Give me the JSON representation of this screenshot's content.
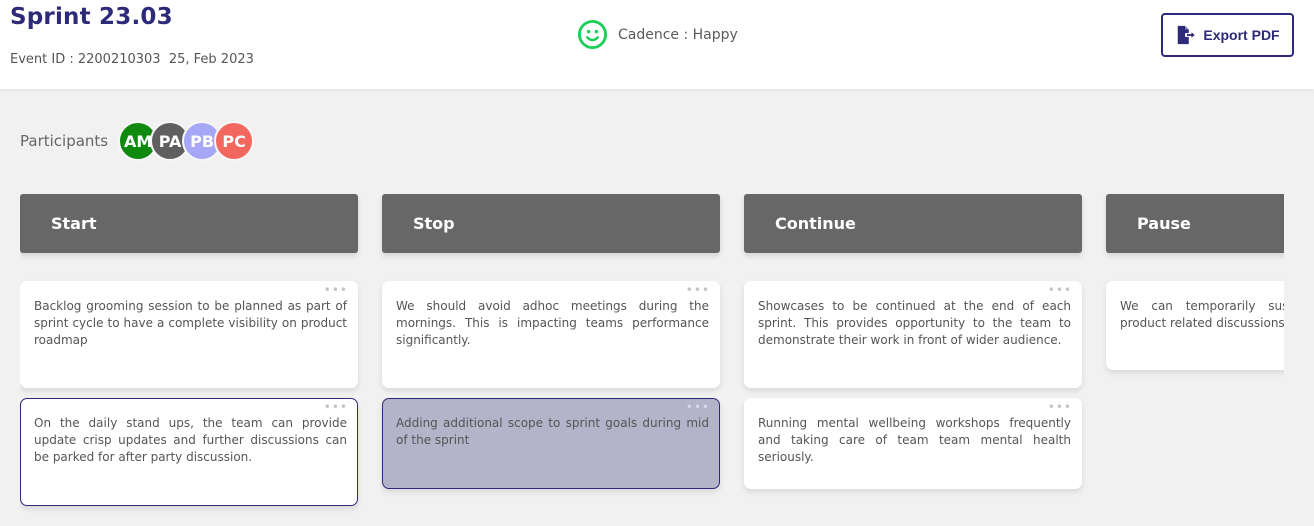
{
  "header": {
    "title": "Sprint 23.03",
    "event_meta": "Event ID : 2200210303  25, Feb 2023",
    "cadence": {
      "label": "Cadence : Happy",
      "icon": "smiley-icon",
      "color": "#1fcf5a"
    },
    "export_button": {
      "label": "Export PDF",
      "icon": "file-export-icon",
      "color": "#2e2a7a"
    }
  },
  "participants": {
    "label": "Participants",
    "avatars": [
      {
        "initials": "AM",
        "color": "#0f8a0f"
      },
      {
        "initials": "PA",
        "color": "#5f5f5f"
      },
      {
        "initials": "PB",
        "color": "#a7a7f7"
      },
      {
        "initials": "PC",
        "color": "#f2685f"
      }
    ]
  },
  "columns": [
    {
      "title": "Start",
      "cards": [
        {
          "text": "Backlog grooming session to be planned as part of sprint cycle to have a complete visibility on product roadmap",
          "menu": "•••"
        },
        {
          "text": "On the daily stand ups, the team can provide update crisp updates and further discussions can be parked for after party discussion.",
          "menu": "•••"
        }
      ]
    },
    {
      "title": "Stop",
      "cards": [
        {
          "text": "We should avoid adhoc meetings during the mornings. This is impacting teams performance significantly.",
          "menu": "•••"
        },
        {
          "text": "Adding additional scope to sprint goals during mid of the sprint",
          "menu": "•••"
        }
      ]
    },
    {
      "title": "Continue",
      "cards": [
        {
          "text": "Showcases to be continued at the end of each sprint. This provides opportunity to the team to demonstrate their work in front of wider audience.",
          "menu": "•••"
        },
        {
          "text": "Running mental wellbeing workshops frequently and taking care of team team mental health seriously.",
          "menu": "•••"
        }
      ]
    },
    {
      "title": "Pause",
      "cards": [
        {
          "text": "We can temporarily suspend product related discussions t",
          "menu": ""
        }
      ]
    }
  ]
}
